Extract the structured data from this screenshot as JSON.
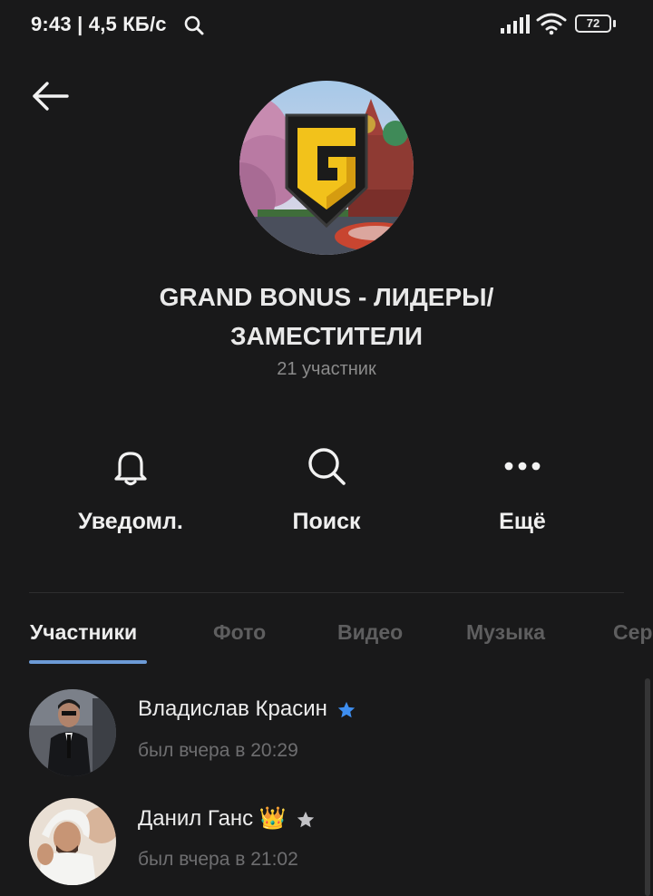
{
  "status_bar": {
    "time_speed": "9:43 | 4,5 КБ/с",
    "battery": "72"
  },
  "group": {
    "title": "GRAND BONUS - ЛИДЕРЫ/ ЗАМЕСТИТЕЛИ",
    "members_count": "21 участник"
  },
  "actions": [
    {
      "label": "Уведомл.",
      "icon": "bell-icon"
    },
    {
      "label": "Поиск",
      "icon": "search-icon"
    },
    {
      "label": "Ещё",
      "icon": "more-dots-icon"
    }
  ],
  "tabs": [
    "Участники",
    "Фото",
    "Видео",
    "Музыка",
    "Сер"
  ],
  "active_tab": "Участники",
  "members": [
    {
      "name": "Владислав Красин",
      "last_seen": "был вчера в 20:29",
      "badge": "star-blue"
    },
    {
      "name": "Данил Ганс",
      "emoji": "👑",
      "last_seen": "был вчера в 21:02",
      "badge": "star-gray"
    }
  ],
  "colors": {
    "background": "#19191a",
    "accent": "#6c9ad6",
    "text_secondary": "#8b8b8b",
    "logo_yellow": "#f2c21b"
  }
}
